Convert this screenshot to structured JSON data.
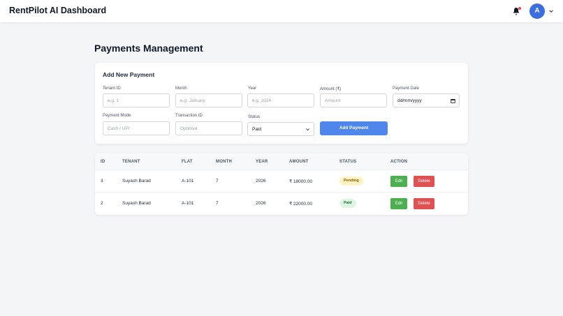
{
  "header": {
    "title": "RentPilot AI Dashboard",
    "bell_icon": "bell-icon",
    "avatar_initial": "A",
    "chevron_icon": "chevron-down-icon",
    "accent_color": "#3b6fe0"
  },
  "page": {
    "title": "Payments Management"
  },
  "form": {
    "title": "Add New Payment",
    "fields": {
      "tenant_id": {
        "label": "Tenant ID",
        "placeholder": "e.g. 1",
        "value": ""
      },
      "month": {
        "label": "Month",
        "placeholder": "e.g. January",
        "value": ""
      },
      "year": {
        "label": "Year",
        "placeholder": "e.g. 2024",
        "value": ""
      },
      "amount": {
        "label": "Amount (₹)",
        "placeholder": "Amount",
        "value": ""
      },
      "payment_date": {
        "label": "Payment Date",
        "value": "dd/mm/yyyy",
        "icon": "calendar-icon"
      },
      "payment_mode": {
        "label": "Payment Mode",
        "placeholder": "Cash / UPI",
        "value": ""
      },
      "transaction_id": {
        "label": "Transaction ID",
        "placeholder": "Optional",
        "value": ""
      },
      "status": {
        "label": "Status",
        "value": "Paid",
        "icon": "chevron-down-icon"
      }
    },
    "submit_label": "Add Payment",
    "submit_color": "#4f86ec"
  },
  "table": {
    "columns": [
      "ID",
      "TENANT",
      "FLAT",
      "MONTH",
      "YEAR",
      "AMOUNT",
      "STATUS",
      "ACTION"
    ],
    "rows": [
      {
        "id": "3",
        "tenant": "Suyash Barad",
        "flat": "A-101",
        "month": "7",
        "year": "2026",
        "amount": "₹ 18000.00",
        "status": "Pending"
      },
      {
        "id": "2",
        "tenant": "Suyash Barad",
        "flat": "A-101",
        "month": "7",
        "year": "2026",
        "amount": "₹ 22000.00",
        "status": "Paid"
      }
    ],
    "edit_label": "Edit",
    "delete_label": "Delete",
    "edit_color": "#4caf50",
    "delete_color": "#e05252"
  }
}
